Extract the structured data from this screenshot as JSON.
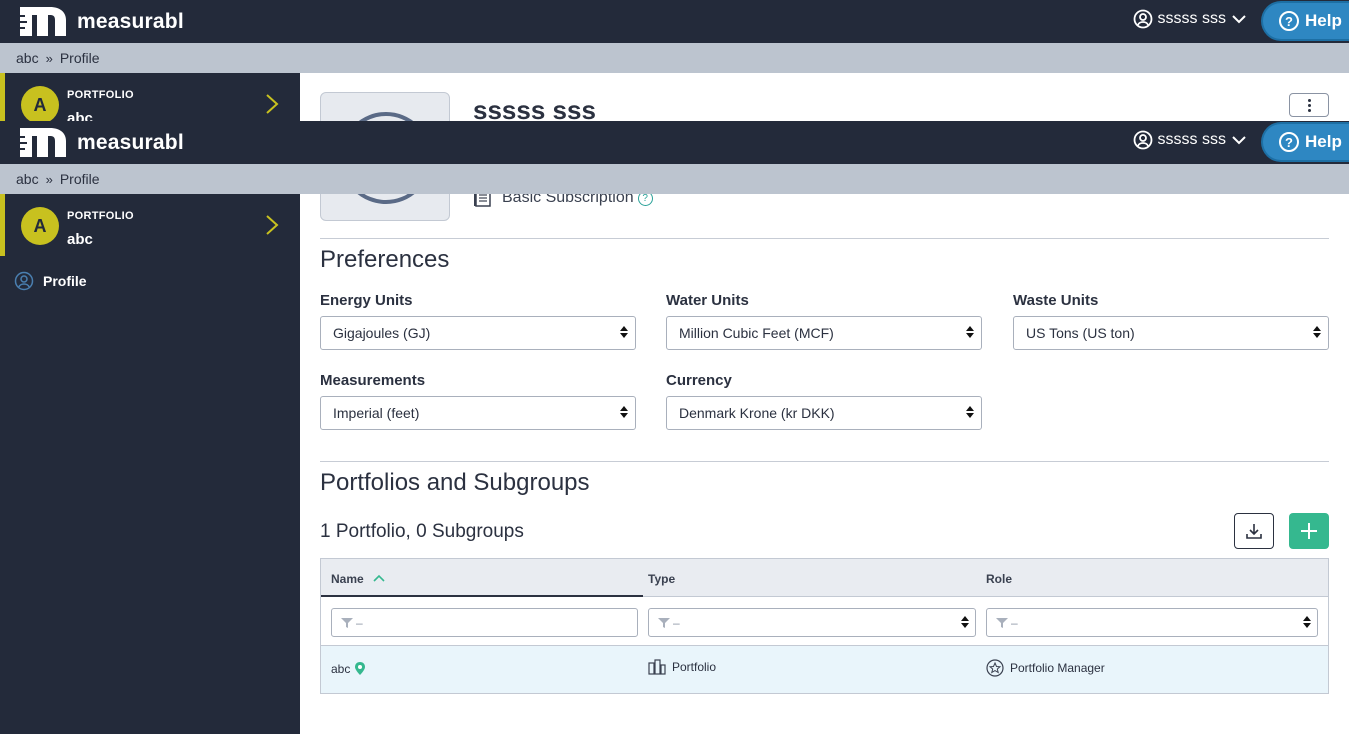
{
  "app": {
    "logo_text": "measurabl",
    "user_name": "sssss sss",
    "help_label": "Help"
  },
  "breadcrumb": {
    "root": "abc",
    "current": "Profile"
  },
  "sidebar": {
    "portfolio_label": "PORTFOLIO",
    "portfolio_name": "abc",
    "avatar_letter": "A",
    "nav_profile": "Profile"
  },
  "profile": {
    "name": "sssss sss",
    "subscription": "Basic Subscription"
  },
  "preferences": {
    "title": "Preferences",
    "energy_label": "Energy Units",
    "energy_value": "Gigajoules (GJ)",
    "water_label": "Water Units",
    "water_value": "Million Cubic Feet (MCF)",
    "waste_label": "Waste Units",
    "waste_value": "US Tons (US ton)",
    "measurements_label": "Measurements",
    "measurements_value": "Imperial (feet)",
    "currency_label": "Currency",
    "currency_value": "Denmark Krone (kr DKK)"
  },
  "portfolios": {
    "title": "Portfolios and Subgroups",
    "count_text": "1 Portfolio, 0 Subgroups",
    "columns": {
      "name": "Name",
      "type": "Type",
      "role": "Role"
    },
    "filter_placeholder": "–",
    "rows": [
      {
        "name": "abc",
        "type": "Portfolio",
        "role": "Portfolio Manager"
      }
    ]
  },
  "colors": {
    "header_bg": "#232a3a",
    "breadcrumb_bg": "#bcc4cf",
    "accent_yellow": "#c8c11f",
    "help_blue": "#2e87c2",
    "add_green": "#35b88f"
  }
}
